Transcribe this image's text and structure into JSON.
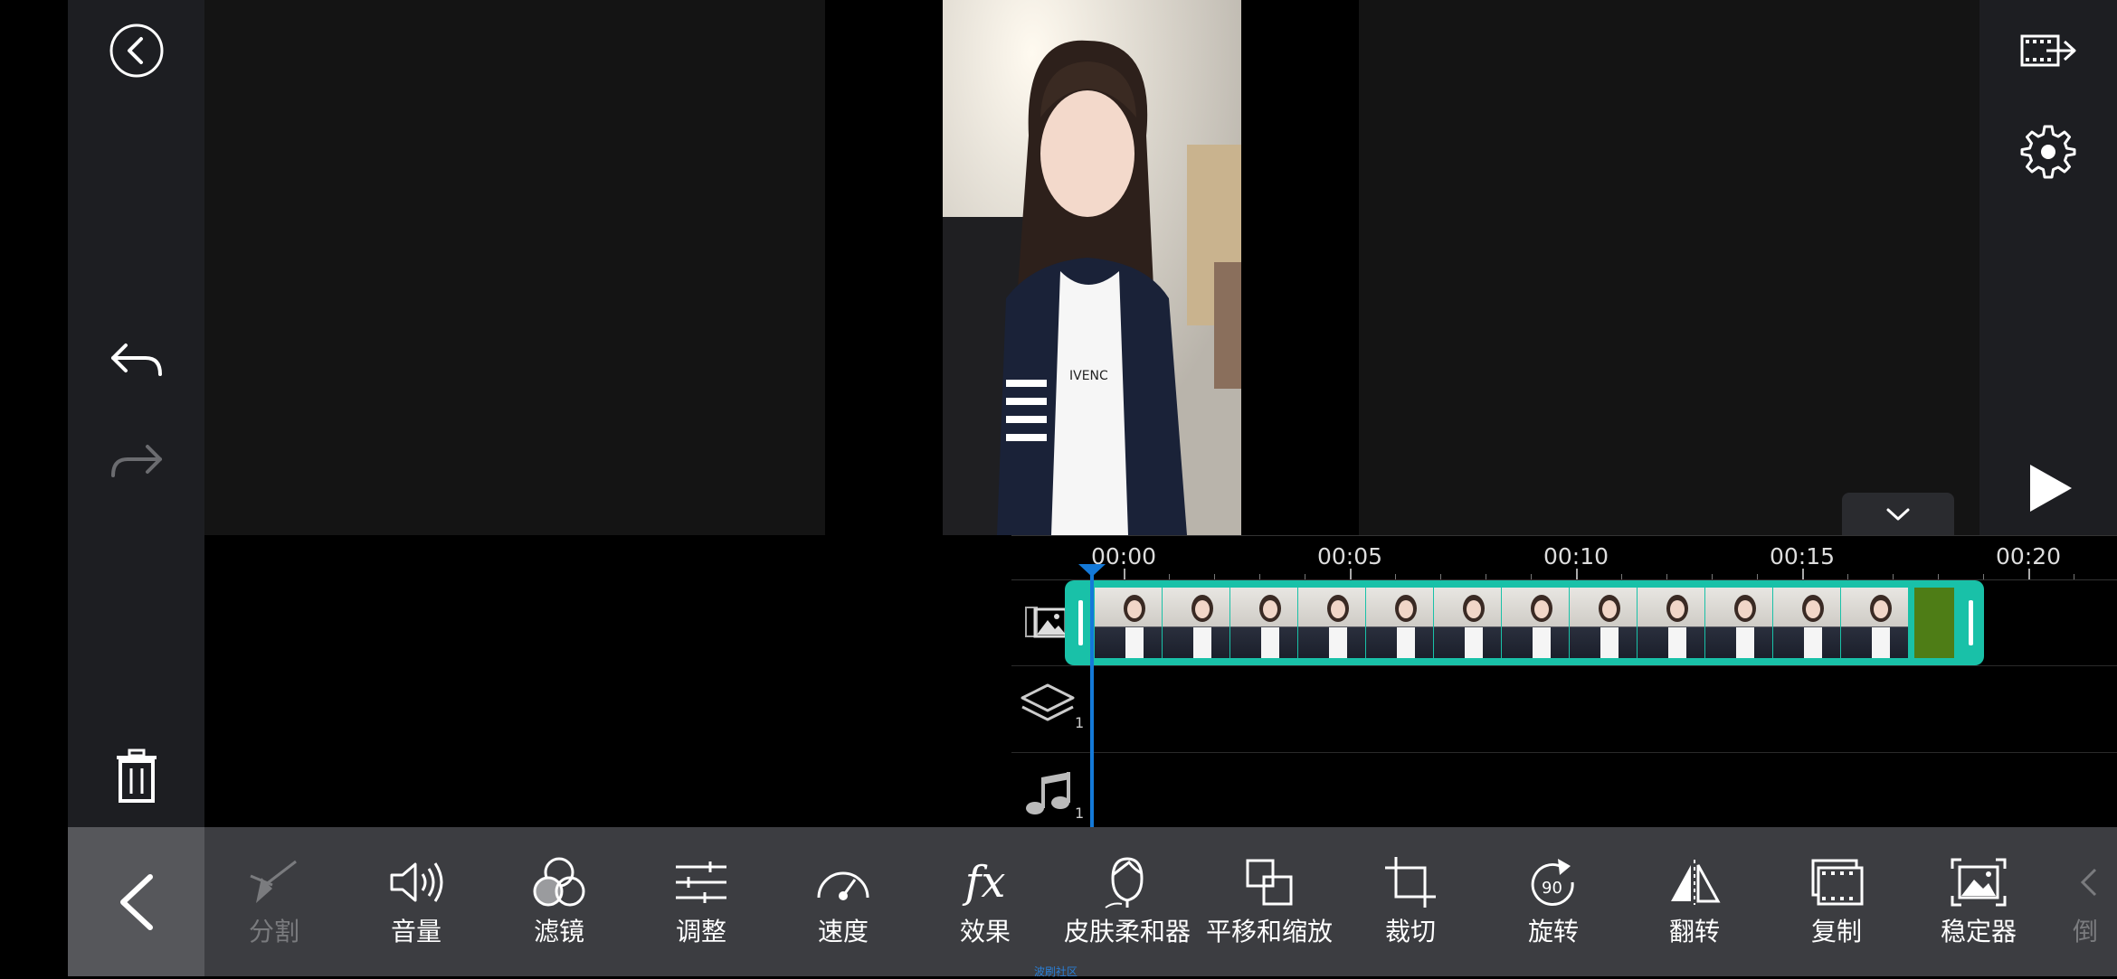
{
  "sidebar": {
    "back_icon": "circle-chevron-left-icon",
    "undo_icon": "undo-arrow-icon",
    "redo_icon": "redo-arrow-icon",
    "delete_icon": "trash-icon"
  },
  "right_sidebar": {
    "export_icon": "export-film-icon",
    "settings_icon": "gear-icon",
    "play_icon": "play-icon"
  },
  "timeline": {
    "ticks": [
      "00:00",
      "00:05",
      "00:10",
      "00:15",
      "00:20"
    ],
    "tracks": [
      {
        "name": "video",
        "icon": "image-film-icon",
        "count": ""
      },
      {
        "name": "layers",
        "icon": "layers-icon",
        "count": "1"
      },
      {
        "name": "audio",
        "icon": "music-note-icon",
        "count": "1"
      }
    ]
  },
  "toolbar": {
    "tools": [
      {
        "label": "分割",
        "icon": "split-icon",
        "enabled": false
      },
      {
        "label": "音量",
        "icon": "volume-icon",
        "enabled": true
      },
      {
        "label": "滤镜",
        "icon": "filter-circles-icon",
        "enabled": true
      },
      {
        "label": "调整",
        "icon": "sliders-icon",
        "enabled": true
      },
      {
        "label": "速度",
        "icon": "speedometer-icon",
        "enabled": true
      },
      {
        "label": "效果",
        "icon": "fx-icon",
        "enabled": true
      },
      {
        "label": "皮肤柔和器",
        "icon": "face-icon",
        "enabled": true
      },
      {
        "label": "平移和缩放",
        "icon": "pan-zoom-icon",
        "enabled": true
      },
      {
        "label": "裁切",
        "icon": "crop-icon",
        "enabled": true
      },
      {
        "label": "旋转",
        "icon": "rotate-90-icon",
        "enabled": true
      },
      {
        "label": "翻转",
        "icon": "flip-icon",
        "enabled": true
      },
      {
        "label": "复制",
        "icon": "duplicate-icon",
        "enabled": true
      },
      {
        "label": "稳定器",
        "icon": "stabilizer-icon",
        "enabled": true
      },
      {
        "label": "倒",
        "icon": "reverse-icon",
        "enabled": false
      }
    ]
  },
  "footer_note": "波刷社区",
  "colors": {
    "accent": "#19c1a8",
    "playhead": "#1479d8",
    "toolbar_bg": "#3c3d41",
    "panel_bg": "#1d1e22"
  }
}
